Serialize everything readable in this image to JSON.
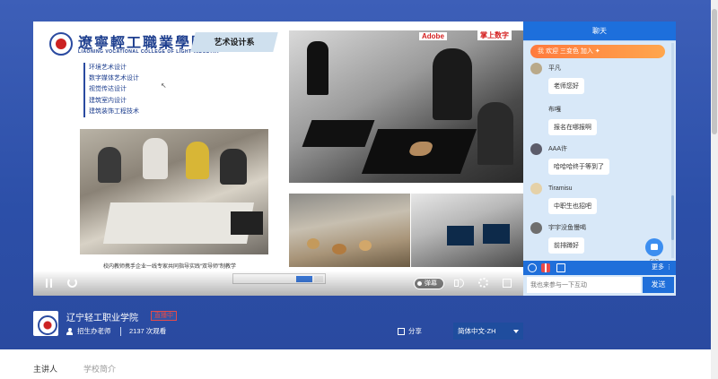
{
  "slide": {
    "school_name_cn": "遼寧輕工職業學院",
    "school_name_en": "LIAONING VOCATIONAL COLLEGE OF LIGHT INDUSTRY",
    "department": "艺术设计系",
    "majors": [
      "环境艺术设计",
      "数字媒体艺术设计",
      "视觉传达设计",
      "建筑室内设计",
      "建筑装饰工程技术"
    ],
    "caption": "校内教师携手企业一线专家共同指导实践“双导师”制教学",
    "sponsor_1": "Adobe",
    "sponsor_2": "掌上数字"
  },
  "player": {
    "danmu_label": "弹幕"
  },
  "chat": {
    "tab_label": "聊天",
    "welcome": {
      "prefix": "我",
      "text": "欢迎",
      "user": "三变色",
      "suffix": "加入"
    },
    "messages": [
      {
        "user": "平凡",
        "text": "老师您好"
      },
      {
        "user": "布嘎",
        "text": "报名在哪报啊"
      },
      {
        "user": "AAA许",
        "text": "哈哈哈终于等到了"
      },
      {
        "user": "Tiramisu",
        "text": "中职生也招吧"
      },
      {
        "user": "宇宇没鱼慢喝",
        "text": "前排蹲好"
      }
    ],
    "like_count": "537",
    "more_label": "更多",
    "input_placeholder": "我也来参与一下互动",
    "send_label": "发送"
  },
  "room": {
    "title": "辽宁轻工职业学院",
    "live_badge": "直播中",
    "host": "招生办老师",
    "views": "2137 次观看",
    "share_label": "分享",
    "language": "简体中文-ZH"
  },
  "tabs": [
    "主讲人",
    "学校简介"
  ],
  "colors": {
    "band": "#2c4fa8",
    "chat_accent": "#1d6fdc",
    "live_red": "#e24b4b"
  }
}
